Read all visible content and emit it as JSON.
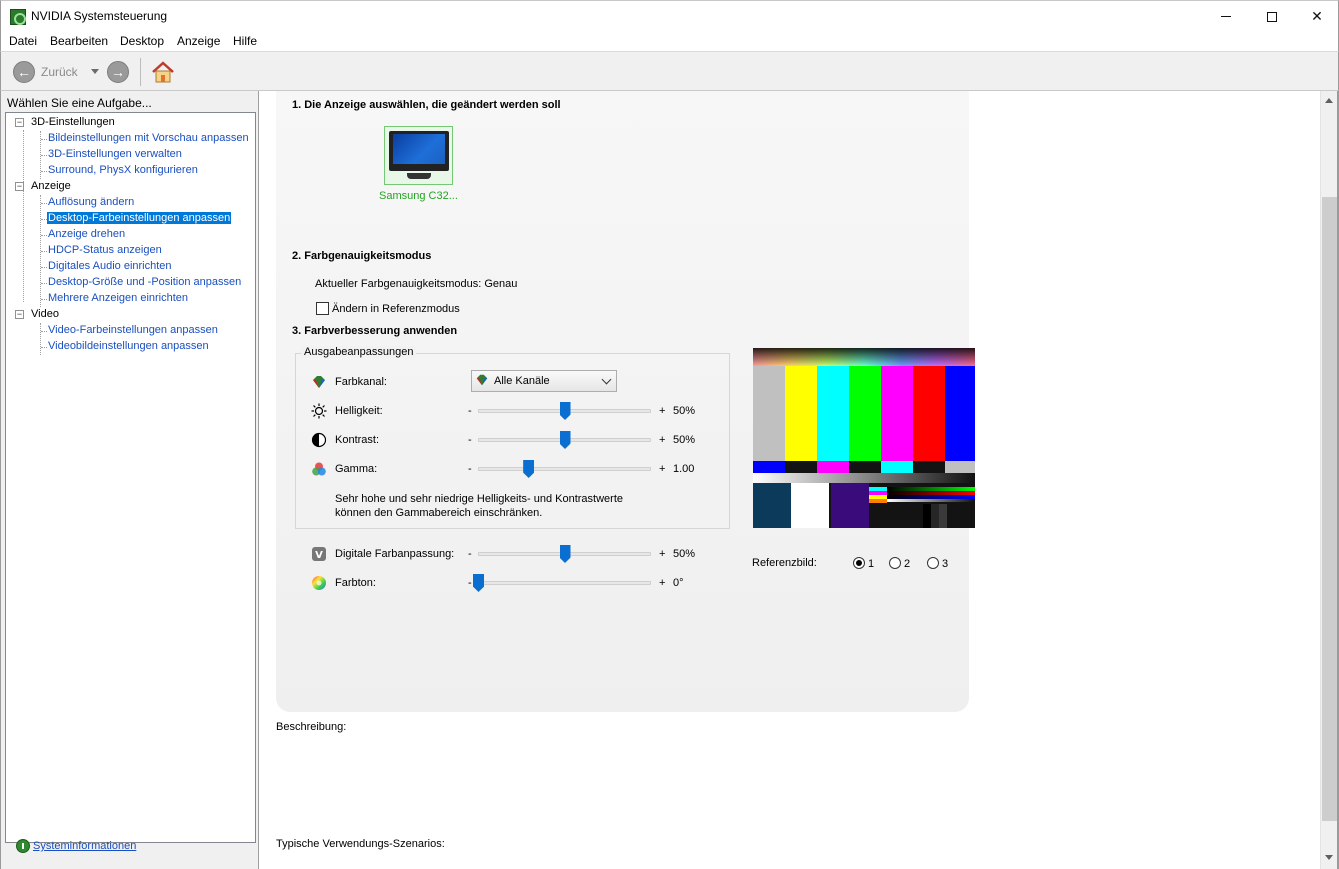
{
  "window": {
    "title": "NVIDIA Systemsteuerung",
    "controls": [
      "minimize",
      "maximize",
      "close"
    ]
  },
  "menu": [
    "Datei",
    "Bearbeiten",
    "Desktop",
    "Anzeige",
    "Hilfe"
  ],
  "toolbar": {
    "back_label": "Zurück"
  },
  "sidebar": {
    "header": "Wählen Sie eine Aufgabe...",
    "categories": [
      {
        "label": "3D-Einstellungen",
        "items": [
          "Bildeinstellungen mit Vorschau anpassen",
          "3D-Einstellungen verwalten",
          "Surround, PhysX konfigurieren"
        ]
      },
      {
        "label": "Anzeige",
        "items": [
          "Auflösung ändern",
          "Desktop-Farbeinstellungen anpassen",
          "Anzeige drehen",
          "HDCP-Status anzeigen",
          "Digitales Audio einrichten",
          "Desktop-Größe und -Position anpassen",
          "Mehrere Anzeigen einrichten"
        ]
      },
      {
        "label": "Video",
        "items": [
          "Video-Farbeinstellungen anpassen",
          "Videobildeinstellungen anpassen"
        ]
      }
    ],
    "selected_item": "Desktop-Farbeinstellungen anpassen",
    "footer_link": "Systeminformationen"
  },
  "main": {
    "section1_title": "1. Die Anzeige auswählen, die geändert werden soll",
    "display_label": "Samsung C32...",
    "section2_title": "2. Farbgenauigkeitsmodus",
    "current_mode": "Aktueller Farbgenauigkeitsmodus: Genau",
    "reference_mode_checkbox": "Ändern in Referenzmodus",
    "reference_mode_checked": false,
    "section3_title": "3. Farbverbesserung anwenden",
    "group_title": "Ausgabeanpassungen",
    "channel_label": "Farbkanal:",
    "channel_value": "Alle Kanäle",
    "sliders": [
      {
        "label": "Helligkeit:",
        "value_text": "50%",
        "fraction": 0.5
      },
      {
        "label": "Kontrast:",
        "value_text": "50%",
        "fraction": 0.5
      },
      {
        "label": "Gamma:",
        "value_text": "1.00",
        "fraction": 0.29
      }
    ],
    "note_line1": "Sehr hohe und sehr niedrige Helligkeits- und Kontrastwerte",
    "note_line2": "können den Gammabereich einschränken.",
    "extra_sliders": [
      {
        "label": "Digitale Farbanpassung:",
        "value_text": "50%",
        "fraction": 0.5
      },
      {
        "label": "Farbton:",
        "value_text": "0°",
        "fraction": 0.0
      }
    ],
    "minus": "-",
    "plus": "+",
    "reference_image_label": "Referenzbild:",
    "reference_options": [
      "1",
      "2",
      "3"
    ],
    "reference_selected": "1",
    "description_label": "Beschreibung:",
    "usage_label": "Typische Verwendungs-Szenarios:"
  },
  "colors": {
    "link": "#1a4fbf",
    "selection": "#0078d7",
    "display_green": "#23a423",
    "slider_thumb": "#0a6fd1"
  }
}
